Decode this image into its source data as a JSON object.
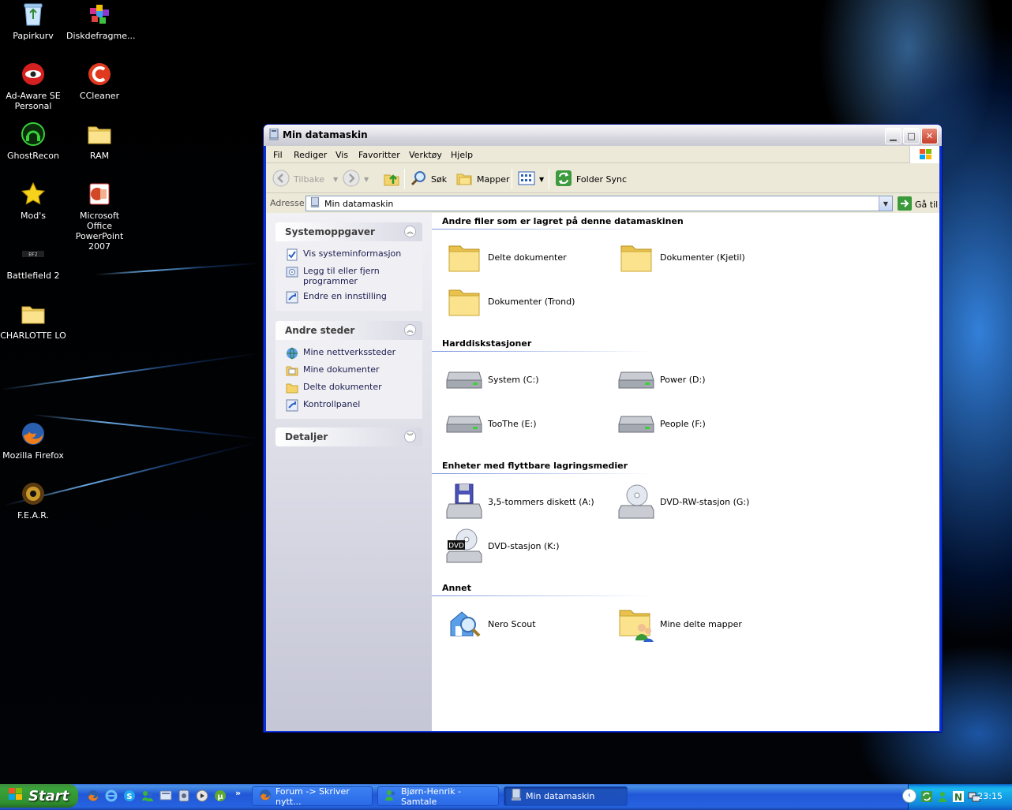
{
  "desktop": {
    "icons": [
      {
        "label": "Papirkurv",
        "icon": "recycle-bin-icon"
      },
      {
        "label": "Diskdefragme...",
        "icon": "defrag-icon"
      },
      {
        "label": "Ad-Aware SE Personal",
        "icon": "ad-aware-icon"
      },
      {
        "label": "CCleaner",
        "icon": "ccleaner-icon"
      },
      {
        "label": "GhostRecon",
        "icon": "ghostrecon-icon"
      },
      {
        "label": "RAM",
        "icon": "folder-icon"
      },
      {
        "label": "Mod's",
        "icon": "star-icon"
      },
      {
        "label": "Microsoft Office PowerPoint 2007",
        "icon": "powerpoint-icon"
      },
      {
        "label": "Battlefield 2",
        "icon": "battlefield-icon"
      },
      {
        "label": "CHARLOTTE LO",
        "icon": "folder-icon"
      },
      {
        "label": "Mozilla Firefox",
        "icon": "firefox-icon"
      },
      {
        "label": "F.E.A.R.",
        "icon": "fear-icon"
      }
    ]
  },
  "window": {
    "title": "Min datamaskin",
    "menu": [
      "Fil",
      "Rediger",
      "Vis",
      "Favoritter",
      "Verktøy",
      "Hjelp"
    ],
    "toolbar": {
      "back": "Tilbake",
      "search": "Søk",
      "folders": "Mapper",
      "folder_sync": "Folder Sync"
    },
    "address": {
      "label": "Adresse",
      "value": "Min datamaskin",
      "go": "Gå til"
    }
  },
  "taskpane": {
    "system_tasks": {
      "title": "Systemoppgaver",
      "items": [
        "Vis systeminformasjon",
        "Legg til eller fjern programmer",
        "Endre en innstilling"
      ]
    },
    "other_places": {
      "title": "Andre steder",
      "items": [
        "Mine nettverkssteder",
        "Mine dokumenter",
        "Delte dokumenter",
        "Kontrollpanel"
      ]
    },
    "details": {
      "title": "Detaljer"
    }
  },
  "content": {
    "groups": [
      {
        "title": "Andre filer som er lagret på denne datamaskinen",
        "items": [
          "Delte dokumenter",
          "Dokumenter (Kjetil)",
          "Dokumenter (Trond)"
        ]
      },
      {
        "title": "Harddiskstasjoner",
        "items": [
          "System (C:)",
          "Power (D:)",
          "TooThe (E:)",
          "People (F:)"
        ]
      },
      {
        "title": "Enheter med flyttbare lagringsmedier",
        "items": [
          "3,5-tommers diskett (A:)",
          "DVD-RW-stasjon (G:)",
          "DVD-stasjon (K:)"
        ]
      },
      {
        "title": "Annet",
        "items": [
          "Nero Scout",
          "Mine delte mapper"
        ]
      }
    ],
    "dvd_badge": "DVD"
  },
  "taskbar": {
    "start": "Start",
    "tasks": [
      "Forum -> Skriver nytt...",
      "Bjørn-Henrik - Samtale",
      "Min datamaskin"
    ],
    "clock": "23:15"
  },
  "colors": {
    "title_accent": "#0831d9",
    "taskbar_blue": "#2157d7",
    "start_green": "#3aa33a",
    "taskpane_link": "#1c1c50"
  }
}
